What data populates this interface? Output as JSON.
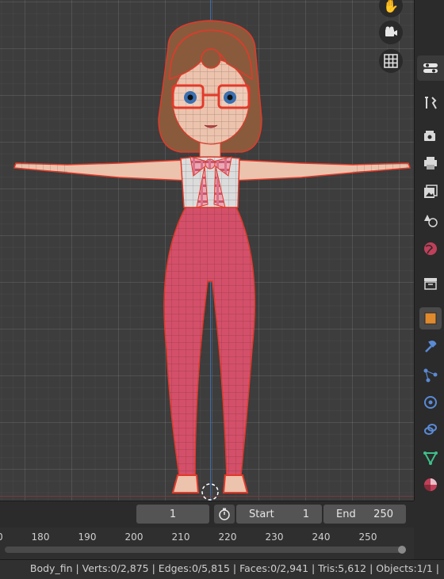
{
  "viewport": {
    "navigation_icons": [
      "hand-icon",
      "camera-icon",
      "grid-icon"
    ]
  },
  "properties_panel": {
    "icons": [
      "tool-icon",
      "render-icon",
      "output-icon",
      "view-layer-icon",
      "scene-icon",
      "world-icon",
      "collection-icon",
      "object-icon",
      "modifier-icon",
      "particles-icon",
      "physics-icon",
      "constraints-icon",
      "data-icon",
      "material-icon"
    ],
    "active": "object-icon"
  },
  "timeline": {
    "current_frame": "1",
    "start_label": "Start",
    "start_value": "1",
    "end_label": "End",
    "end_value": "250",
    "ticks": [
      "0",
      "180",
      "190",
      "200",
      "210",
      "220",
      "230",
      "240",
      "250"
    ]
  },
  "status": {
    "text": "Body_fin | Verts:0/2,875 | Edges:0/5,815 | Faces:0/2,941 | Tris:5,612 | Objects:1/1 |"
  },
  "colors": {
    "viewport_bg": "#3d3d3d",
    "selection_outline": "#e23a2a",
    "active_icon": "#e08a2e"
  }
}
